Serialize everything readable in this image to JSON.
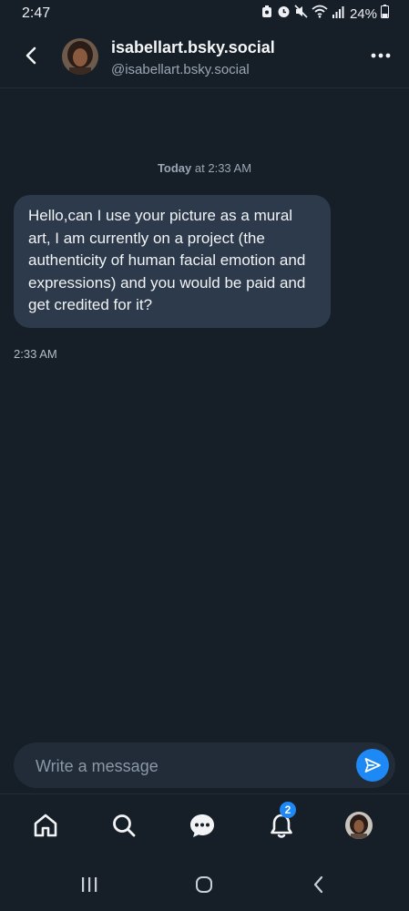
{
  "status_bar": {
    "time": "2:47",
    "battery": "24%",
    "icons": [
      "alarm-icon",
      "mute-icon",
      "wifi-icon",
      "signal-icon",
      "battery-icon"
    ]
  },
  "header": {
    "display_name": "isabellart.bsky.social",
    "handle": "@isabellart.bsky.social",
    "back_icon": "chevron-left-icon",
    "more_icon": "more-horizontal-icon"
  },
  "conversation": {
    "date_label_bold": "Today",
    "date_label_rest": " at 2:33 AM",
    "messages": [
      {
        "text": "Hello,can I use your picture as a mural art, I am currently on a project (the authenticity of human facial emotion and expressions) and you would be paid and get credited for it?",
        "time": "2:33 AM"
      }
    ]
  },
  "composer": {
    "placeholder": "Write a message",
    "value": "",
    "send_icon": "send-icon"
  },
  "bottom_nav": {
    "items": [
      "home-icon",
      "search-icon",
      "chat-icon",
      "bell-icon",
      "profile-avatar"
    ],
    "notifications_badge": "2"
  },
  "colors": {
    "background": "#161e27",
    "bubble": "#2c3a4b",
    "accent": "#1e88f5",
    "muted_text": "#9aa6b4"
  }
}
